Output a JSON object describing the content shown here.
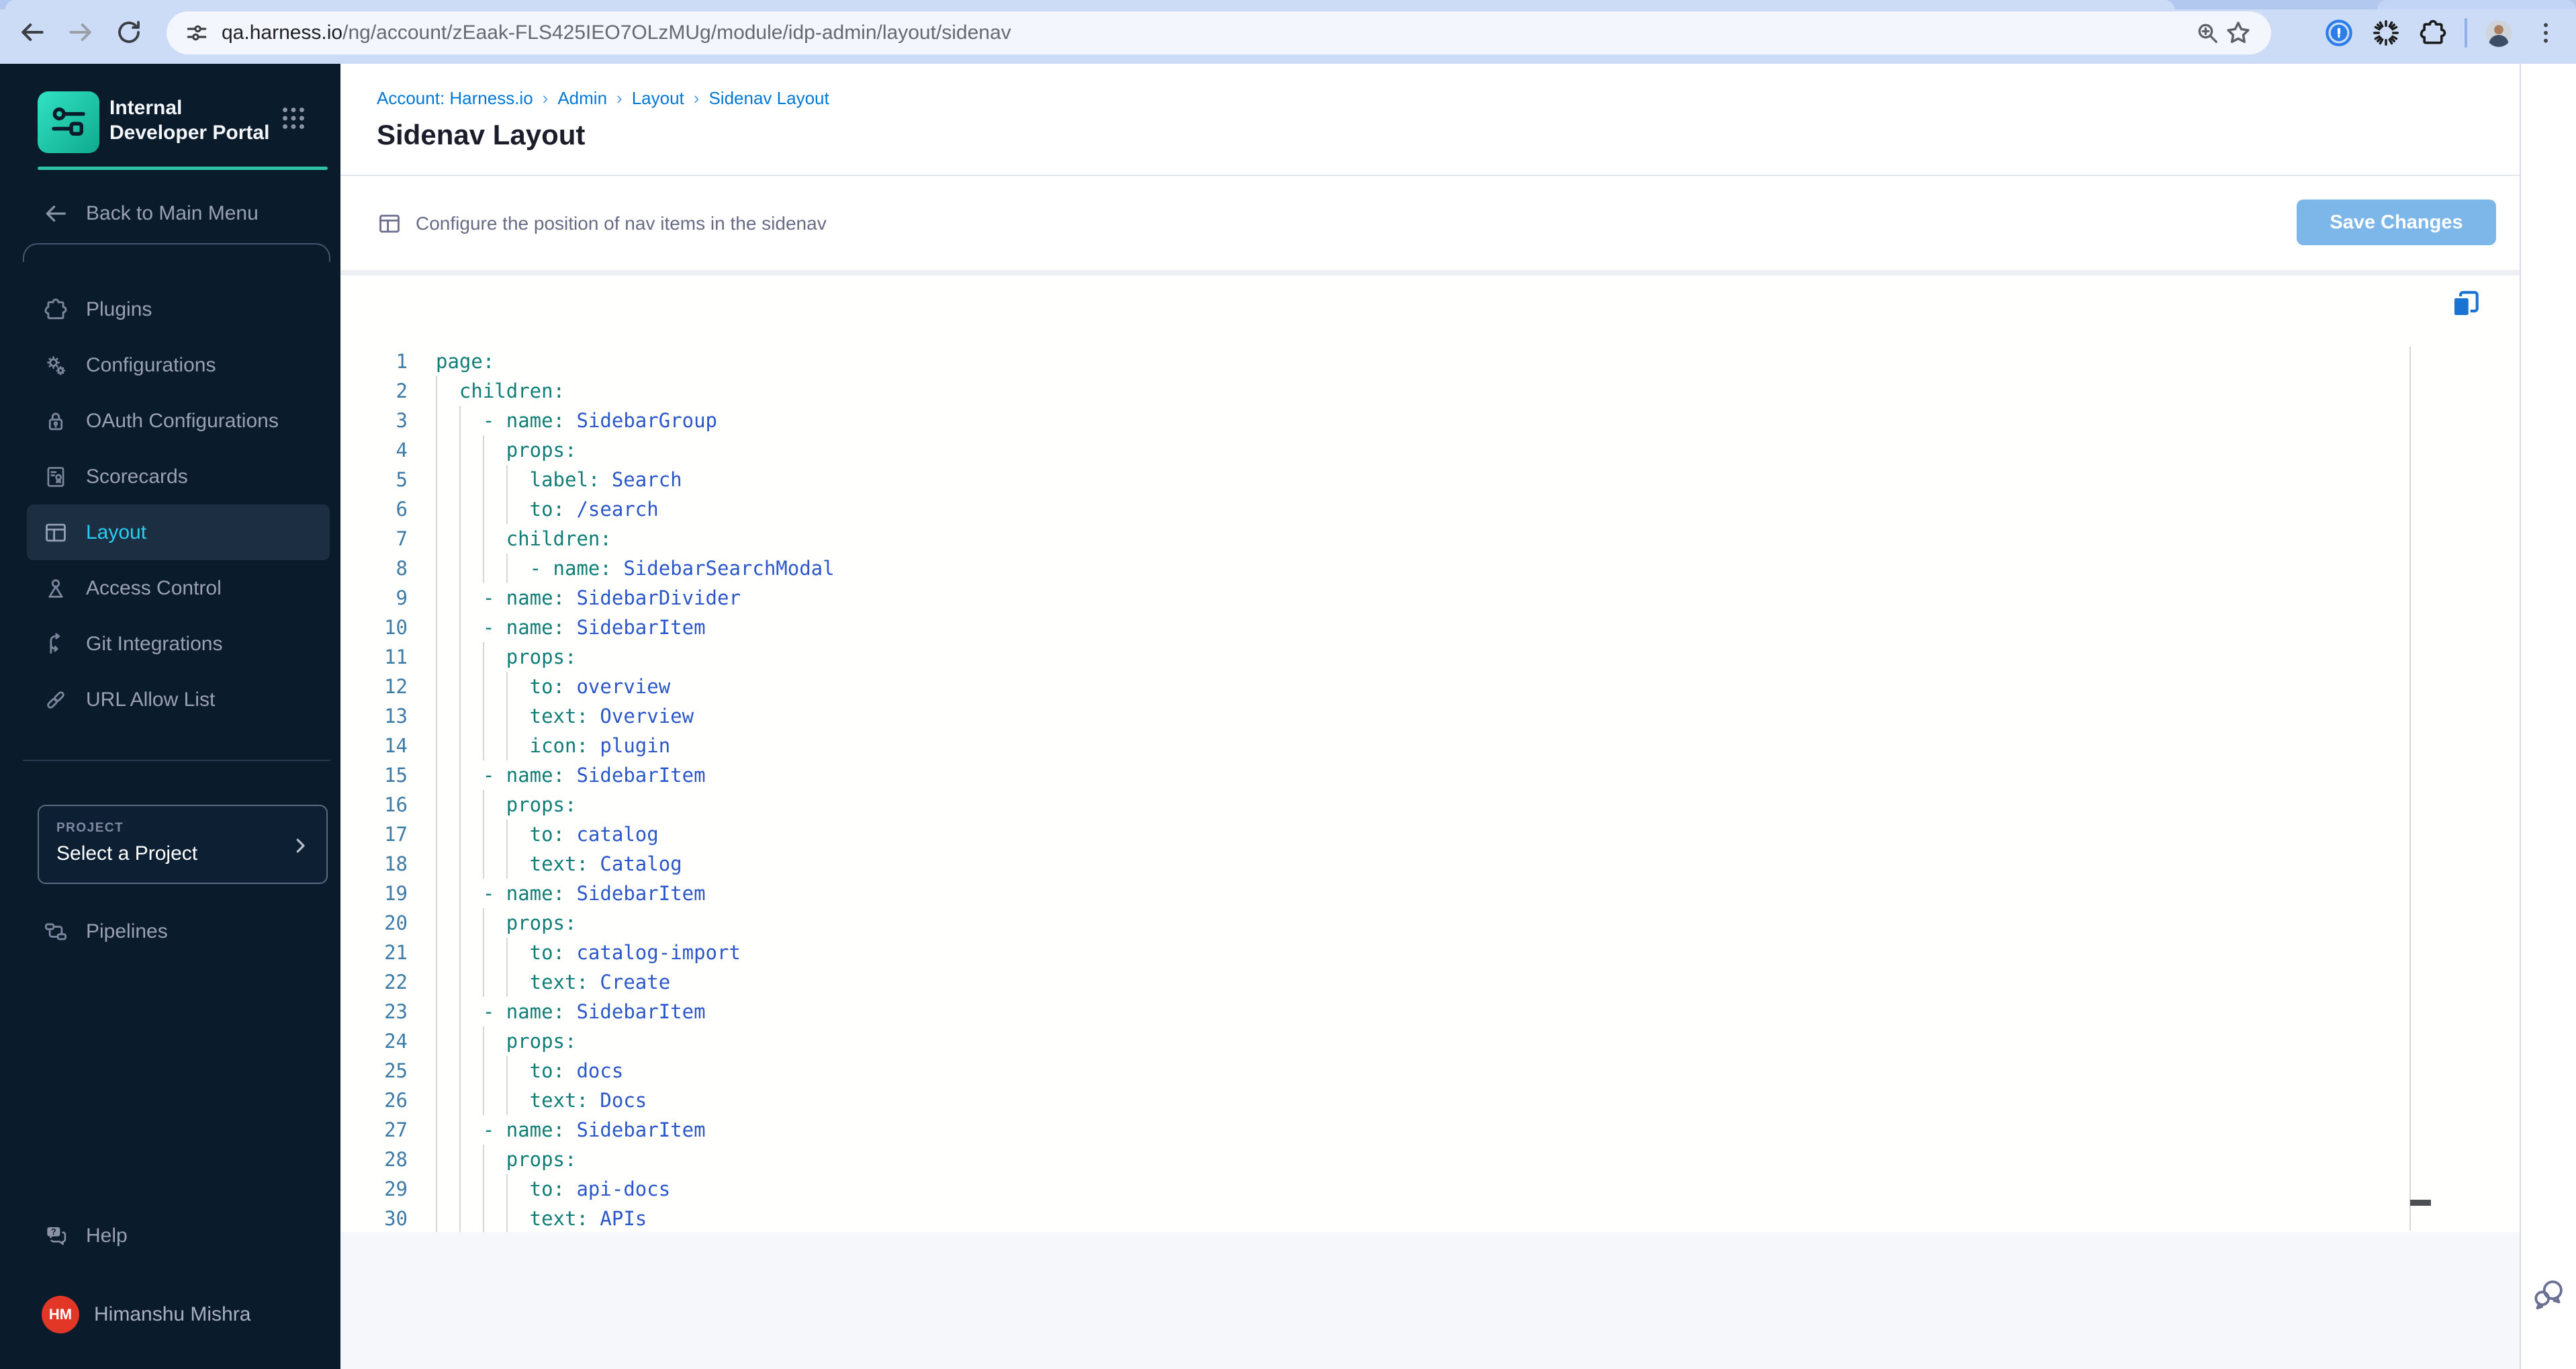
{
  "browser": {
    "url_host": "qa.harness.io",
    "url_path": "/ng/account/zEaak-FLS425IEO7OLzMUg/module/idp-admin/layout/sidenav"
  },
  "sidebar": {
    "product_title": "Internal Developer Portal",
    "back_label": "Back to Main Menu",
    "items": [
      {
        "label": "Plugins",
        "icon": "puzzle",
        "active": false
      },
      {
        "label": "Configurations",
        "icon": "gears",
        "active": false
      },
      {
        "label": "OAuth Configurations",
        "icon": "lock",
        "active": false
      },
      {
        "label": "Scorecards",
        "icon": "scorecard",
        "active": false
      },
      {
        "label": "Layout",
        "icon": "layout",
        "active": true
      },
      {
        "label": "Access Control",
        "icon": "person",
        "active": false
      },
      {
        "label": "Git Integrations",
        "icon": "git",
        "active": false
      },
      {
        "label": "URL Allow List",
        "icon": "link",
        "active": false
      }
    ],
    "project_label": "PROJECT",
    "project_value": "Select a Project",
    "pipelines_label": "Pipelines",
    "help_label": "Help",
    "user_initials": "HM",
    "user_name": "Himanshu Mishra"
  },
  "header": {
    "breadcrumbs": [
      "Account: Harness.io",
      "Admin",
      "Layout",
      "Sidenav Layout"
    ],
    "title": "Sidenav Layout"
  },
  "toolbar": {
    "description": "Configure the position of nav items in the sidenav",
    "save_label": "Save Changes"
  },
  "editor": {
    "lines": [
      {
        "n": 1,
        "ind": 0,
        "dash": false,
        "key": "page",
        "val": ""
      },
      {
        "n": 2,
        "ind": 2,
        "dash": false,
        "key": "children",
        "val": ""
      },
      {
        "n": 3,
        "ind": 4,
        "dash": true,
        "key": "name",
        "val": "SidebarGroup"
      },
      {
        "n": 4,
        "ind": 6,
        "dash": false,
        "key": "props",
        "val": ""
      },
      {
        "n": 5,
        "ind": 8,
        "dash": false,
        "key": "label",
        "val": "Search"
      },
      {
        "n": 6,
        "ind": 8,
        "dash": false,
        "key": "to",
        "val": "/search"
      },
      {
        "n": 7,
        "ind": 6,
        "dash": false,
        "key": "children",
        "val": ""
      },
      {
        "n": 8,
        "ind": 8,
        "dash": true,
        "key": "name",
        "val": "SidebarSearchModal"
      },
      {
        "n": 9,
        "ind": 4,
        "dash": true,
        "key": "name",
        "val": "SidebarDivider"
      },
      {
        "n": 10,
        "ind": 4,
        "dash": true,
        "key": "name",
        "val": "SidebarItem"
      },
      {
        "n": 11,
        "ind": 6,
        "dash": false,
        "key": "props",
        "val": ""
      },
      {
        "n": 12,
        "ind": 8,
        "dash": false,
        "key": "to",
        "val": "overview"
      },
      {
        "n": 13,
        "ind": 8,
        "dash": false,
        "key": "text",
        "val": "Overview"
      },
      {
        "n": 14,
        "ind": 8,
        "dash": false,
        "key": "icon",
        "val": "plugin"
      },
      {
        "n": 15,
        "ind": 4,
        "dash": true,
        "key": "name",
        "val": "SidebarItem"
      },
      {
        "n": 16,
        "ind": 6,
        "dash": false,
        "key": "props",
        "val": ""
      },
      {
        "n": 17,
        "ind": 8,
        "dash": false,
        "key": "to",
        "val": "catalog"
      },
      {
        "n": 18,
        "ind": 8,
        "dash": false,
        "key": "text",
        "val": "Catalog"
      },
      {
        "n": 19,
        "ind": 4,
        "dash": true,
        "key": "name",
        "val": "SidebarItem"
      },
      {
        "n": 20,
        "ind": 6,
        "dash": false,
        "key": "props",
        "val": ""
      },
      {
        "n": 21,
        "ind": 8,
        "dash": false,
        "key": "to",
        "val": "catalog-import"
      },
      {
        "n": 22,
        "ind": 8,
        "dash": false,
        "key": "text",
        "val": "Create"
      },
      {
        "n": 23,
        "ind": 4,
        "dash": true,
        "key": "name",
        "val": "SidebarItem"
      },
      {
        "n": 24,
        "ind": 6,
        "dash": false,
        "key": "props",
        "val": ""
      },
      {
        "n": 25,
        "ind": 8,
        "dash": false,
        "key": "to",
        "val": "docs"
      },
      {
        "n": 26,
        "ind": 8,
        "dash": false,
        "key": "text",
        "val": "Docs"
      },
      {
        "n": 27,
        "ind": 4,
        "dash": true,
        "key": "name",
        "val": "SidebarItem"
      },
      {
        "n": 28,
        "ind": 6,
        "dash": false,
        "key": "props",
        "val": ""
      },
      {
        "n": 29,
        "ind": 8,
        "dash": false,
        "key": "to",
        "val": "api-docs"
      },
      {
        "n": 30,
        "ind": 8,
        "dash": false,
        "key": "text",
        "val": "APIs"
      }
    ]
  },
  "colors": {
    "sidebar_bg": "#0a1b2b",
    "active_item_text": "#2acdf2",
    "accent_teal": "#2cc3a7",
    "breadcrumb_blue": "#0278d5",
    "save_button": "#7db7ea",
    "yaml_key": "#107d77",
    "yaml_value": "#2c57c9",
    "line_number": "#3e7ba6",
    "avatar_red": "#e23726",
    "copy_icon_blue": "#1873d3"
  }
}
